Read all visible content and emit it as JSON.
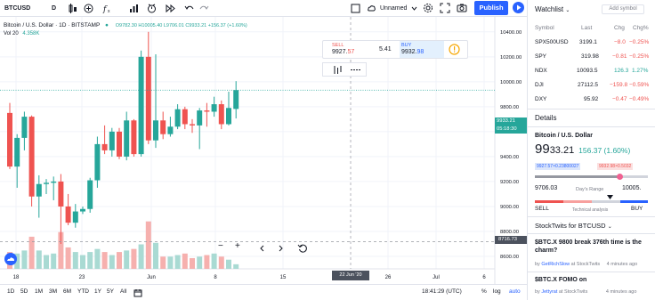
{
  "topbar": {
    "symbol": "BTCUSD",
    "interval": "D",
    "unnamed_label": "Unnamed",
    "publish_label": "Publish"
  },
  "legend": {
    "title": "Bitcoin / U.S. Dollar",
    "interval": "1D",
    "exchange": "BITSTAMP",
    "ohlc": "O9782.30 H10005.40 L9706.01 C9933.21 +156.37 (+1.60%)",
    "vol_label": "Vol 20",
    "vol_value": "4.358K"
  },
  "trade_panel": {
    "sell_label": "SELL",
    "sell_price_a": "9927.",
    "sell_price_b": "57",
    "spread": "5.41",
    "buy_label": "BUY",
    "buy_price_a": "9932.",
    "buy_price_b": "98"
  },
  "price_axis": {
    "labels": [
      "10400.00",
      "10200.00",
      "10000.00",
      "9800.00",
      "9600.00",
      "9400.00",
      "9200.00",
      "9000.00",
      "8800.00",
      "8600.00"
    ],
    "current_price": "9933.21",
    "countdown": "05:18:30",
    "crosshair_price": "8716.73"
  },
  "time_axis": {
    "labels": [
      "18",
      "23",
      "Jun",
      "8",
      "15",
      "26",
      "Jul",
      "6"
    ],
    "crosshair_date": "22 Jun '20"
  },
  "chart_controls": {
    "minus": "−",
    "plus": "+"
  },
  "bottombar": {
    "ranges": [
      "1D",
      "5D",
      "1M",
      "3M",
      "6M",
      "YTD",
      "1Y",
      "5Y",
      "All"
    ],
    "clock": "18:41:29 (UTC)",
    "pct": "%",
    "log": "log",
    "auto": "auto"
  },
  "watchlist": {
    "title": "Watchlist",
    "add_symbol": "Add symbol",
    "headers": [
      "Symbol",
      "Last",
      "Chg",
      "Chg%"
    ],
    "rows": [
      {
        "symbol": "SPX500USD",
        "last": "3199.1",
        "chg": "−8.0",
        "chgp": "−0.25%",
        "dir": "down"
      },
      {
        "symbol": "SPY",
        "last": "319.98",
        "chg": "−0.81",
        "chgp": "−0.25%",
        "dir": "down"
      },
      {
        "symbol": "NDX",
        "last": "10093.5",
        "chg": "126.3",
        "chgp": "1.27%",
        "dir": "up"
      },
      {
        "symbol": "DJI",
        "last": "27112.5",
        "chg": "−159.8",
        "chgp": "−0.59%",
        "dir": "down"
      },
      {
        "symbol": "DXY",
        "last": "95.92",
        "chg": "−0.47",
        "chgp": "−0.49%",
        "dir": "down"
      }
    ]
  },
  "details": {
    "title": "Details",
    "name": "Bitcoin / U.S. Dollar",
    "price_big": "99",
    "price_rest": "33.21",
    "change": "156.37 (1.60%)",
    "bid": "9927.57×0.23800027",
    "ask": "9932.98×0.5032",
    "low": "9706.03",
    "range_label": "Day's Range",
    "high": "10005.",
    "range_level": 0.75,
    "sell_label": "SELL",
    "tech_label": "Technical analysis",
    "buy_label": "BUY"
  },
  "stocktwits": {
    "title": "StockTwits for BTCUSD",
    "posts": [
      {
        "text": "$BTC.X 9800 break 376th time is the charm?",
        "by": "by",
        "author": "GetRichSlow",
        "source": "at StockTwits",
        "time": "4 minutes ago"
      },
      {
        "text": "$BTC.X FOMO on",
        "by": "by",
        "author": "Jettyrat",
        "source": "at StockTwits",
        "time": "4 minutes ago"
      }
    ]
  },
  "colors": {
    "up": "#26a69a",
    "down": "#ef5350",
    "vol_up": "#a9dad3",
    "vol_down": "#f6b0ae",
    "accent": "#2962ff"
  },
  "chart_data": {
    "type": "candlestick",
    "ylim": [
      8500,
      10520
    ],
    "candles": [
      {
        "o": 9750,
        "h": 9830,
        "l": 9300,
        "c": 9320,
        "v": 0.55
      },
      {
        "o": 9320,
        "h": 9580,
        "l": 9150,
        "c": 9550,
        "v": 0.5
      },
      {
        "o": 9550,
        "h": 9760,
        "l": 9450,
        "c": 9720,
        "v": 0.6
      },
      {
        "o": 9720,
        "h": 9730,
        "l": 9000,
        "c": 9080,
        "v": 1.05
      },
      {
        "o": 9080,
        "h": 9250,
        "l": 8910,
        "c": 9180,
        "v": 0.6
      },
      {
        "o": 9180,
        "h": 9220,
        "l": 9100,
        "c": 9190,
        "v": 0.45
      },
      {
        "o": 9190,
        "h": 9240,
        "l": 9050,
        "c": 9200,
        "v": 0.5
      },
      {
        "o": 9200,
        "h": 9260,
        "l": 8700,
        "c": 9000,
        "v": 1.2
      },
      {
        "o": 9000,
        "h": 9100,
        "l": 8850,
        "c": 8870,
        "v": 0.7
      },
      {
        "o": 8870,
        "h": 9020,
        "l": 8830,
        "c": 8960,
        "v": 0.55
      },
      {
        "o": 8960,
        "h": 9000,
        "l": 8940,
        "c": 8980,
        "v": 0.45
      },
      {
        "o": 8980,
        "h": 9230,
        "l": 8950,
        "c": 9210,
        "v": 0.55
      },
      {
        "o": 9210,
        "h": 9560,
        "l": 9150,
        "c": 9500,
        "v": 0.65
      },
      {
        "o": 9500,
        "h": 9650,
        "l": 9420,
        "c": 9450,
        "v": 0.55
      },
      {
        "o": 9450,
        "h": 9630,
        "l": 9400,
        "c": 9600,
        "v": 0.45
      },
      {
        "o": 9600,
        "h": 9630,
        "l": 9380,
        "c": 9400,
        "v": 0.55
      },
      {
        "o": 9400,
        "h": 9760,
        "l": 9370,
        "c": 9690,
        "v": 0.6
      },
      {
        "o": 9690,
        "h": 9700,
        "l": 9400,
        "c": 9420,
        "v": 0.65
      },
      {
        "o": 9420,
        "h": 10250,
        "l": 9400,
        "c": 10200,
        "v": 0.8
      },
      {
        "o": 10200,
        "h": 10400,
        "l": 9500,
        "c": 9530,
        "v": 1.55
      },
      {
        "o": 9530,
        "h": 10220,
        "l": 9470,
        "c": 9690,
        "v": 0.85
      },
      {
        "o": 9690,
        "h": 9760,
        "l": 9540,
        "c": 9580,
        "v": 0.4
      },
      {
        "o": 9580,
        "h": 9720,
        "l": 9560,
        "c": 9640,
        "v": 0.4
      },
      {
        "o": 9640,
        "h": 9820,
        "l": 9620,
        "c": 9780,
        "v": 0.45
      },
      {
        "o": 9780,
        "h": 9800,
        "l": 9620,
        "c": 9660,
        "v": 0.5
      },
      {
        "o": 9660,
        "h": 9700,
        "l": 9590,
        "c": 9650,
        "v": 0.35
      },
      {
        "o": 9650,
        "h": 9790,
        "l": 9460,
        "c": 9770,
        "v": 0.4
      },
      {
        "o": 9770,
        "h": 9830,
        "l": 9640,
        "c": 9760,
        "v": 0.45
      },
      {
        "o": 9760,
        "h": 9880,
        "l": 9720,
        "c": 9820,
        "v": 0.5
      },
      {
        "o": 9820,
        "h": 9850,
        "l": 9620,
        "c": 9660,
        "v": 0.4
      },
      {
        "o": 9660,
        "h": 9920,
        "l": 9650,
        "c": 9790,
        "v": 0.3
      },
      {
        "o": 9782,
        "h": 10005,
        "l": 9706,
        "c": 9933,
        "v": 0.15
      }
    ]
  }
}
